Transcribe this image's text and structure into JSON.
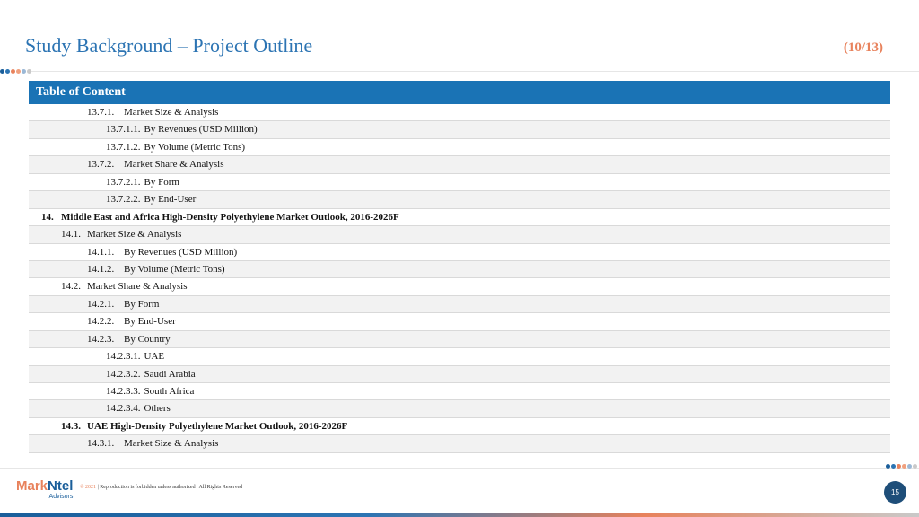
{
  "header": {
    "title": "Study Background – Project Outline",
    "page_indicator": "(10/13)"
  },
  "toc": {
    "header": "Table of Content",
    "rows": [
      {
        "num": "13.7.1.",
        "text": "Market Size & Analysis",
        "level": 2
      },
      {
        "num": "13.7.1.1.",
        "text": "By Revenues (USD Million)",
        "level": 3
      },
      {
        "num": "13.7.1.2.",
        "text": "By Volume (Metric Tons)",
        "level": 3
      },
      {
        "num": "13.7.2.",
        "text": "Market Share & Analysis",
        "level": 2
      },
      {
        "num": "13.7.2.1.",
        "text": "By Form",
        "level": 3
      },
      {
        "num": "13.7.2.2.",
        "text": "By End-User",
        "level": 3
      },
      {
        "num": "14.",
        "text": "Middle East and Africa High-Density Polyethylene Market Outlook, 2016-2026F",
        "level": 0
      },
      {
        "num": "14.1.",
        "text": "Market Size & Analysis",
        "level": 1
      },
      {
        "num": "14.1.1.",
        "text": "By Revenues (USD Million)",
        "level": 2
      },
      {
        "num": "14.1.2.",
        "text": "By Volume (Metric Tons)",
        "level": 2
      },
      {
        "num": "14.2.",
        "text": "Market Share & Analysis",
        "level": 1
      },
      {
        "num": "14.2.1.",
        "text": "By Form",
        "level": 2
      },
      {
        "num": "14.2.2.",
        "text": "By End-User",
        "level": 2
      },
      {
        "num": "14.2.3.",
        "text": "By Country",
        "level": 2
      },
      {
        "num": "14.2.3.1.",
        "text": "UAE",
        "level": 3
      },
      {
        "num": "14.2.3.2.",
        "text": "Saudi Arabia",
        "level": 3
      },
      {
        "num": "14.2.3.3.",
        "text": "South Africa",
        "level": 3
      },
      {
        "num": "14.2.3.4.",
        "text": "Others",
        "level": 3
      },
      {
        "num": "14.3.",
        "text": "UAE High-Density Polyethylene Market Outlook, 2016-2026F",
        "level": 1,
        "bold": true
      },
      {
        "num": "14.3.1.",
        "text": "Market Size & Analysis",
        "level": 2
      }
    ]
  },
  "footer": {
    "logo_mark": "Mark",
    "logo_ntel": "Ntel",
    "logo_sub": "Advisors",
    "copyright_year": "© 2021",
    "copyright_text": "| Reproduction is forbidden unless authorized | All Rights Reserved",
    "page_number": "15"
  },
  "colors": {
    "accent_blue": "#1a73b5",
    "accent_orange": "#e8825c",
    "dots": [
      "#1a5e9a",
      "#2c74b3",
      "#e8825c",
      "#f0a07e",
      "#9bb8d6",
      "#c9c9c9"
    ]
  }
}
